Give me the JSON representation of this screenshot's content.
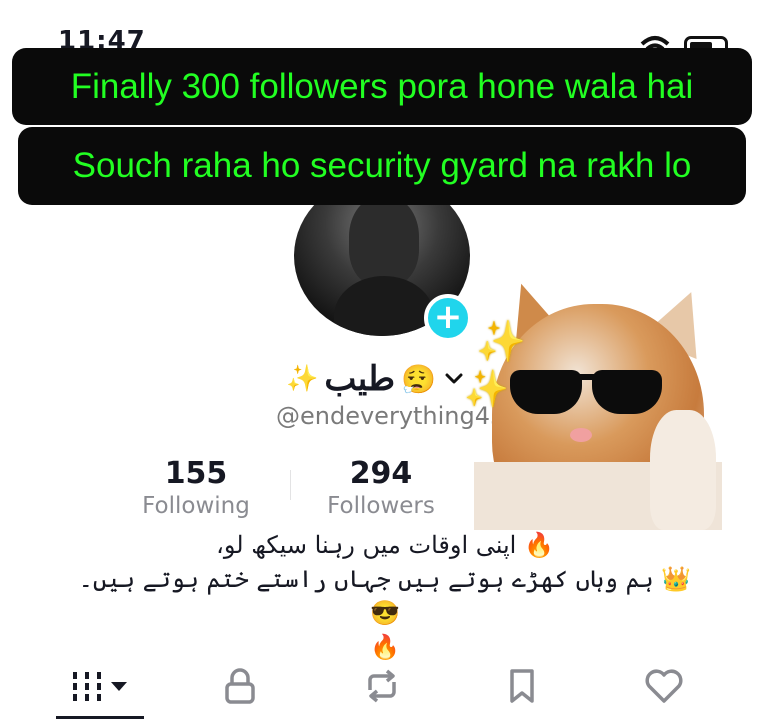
{
  "status_bar": {
    "time": "11:47"
  },
  "captions": {
    "line1": "Finally 300 followers pora hone wala hai",
    "line2": "Souch raha ho security gyard na rakh lo"
  },
  "profile": {
    "sparkle": "✨",
    "display_name": "طیب",
    "name_emoji": "😮‍💨",
    "username": "@endeverything45",
    "following_count": "155",
    "following_label": "Following",
    "followers_count": "294",
    "followers_label": "Followers",
    "bio_line1": "🔥 اپنی اوقات میں رہنا سیکھ لو،",
    "bio_line2": "👑 ہم وہاں کھڑے ہوتے ہیں جہاں راستے ختم ہوتے ہیں۔ 😎",
    "bio_line3": "🔥"
  },
  "sticker": {
    "stars": "✨"
  },
  "tabs": [
    {
      "name": "videos",
      "icon": "grid-icon"
    },
    {
      "name": "private",
      "icon": "lock-icon"
    },
    {
      "name": "reposts",
      "icon": "repost-icon"
    },
    {
      "name": "favorites",
      "icon": "bookmark-icon"
    },
    {
      "name": "liked",
      "icon": "heart-icon"
    }
  ],
  "colors": {
    "caption_text": "#22ff22",
    "caption_bg": "#0a0a0a",
    "follow_badge": "#20d5ec"
  }
}
